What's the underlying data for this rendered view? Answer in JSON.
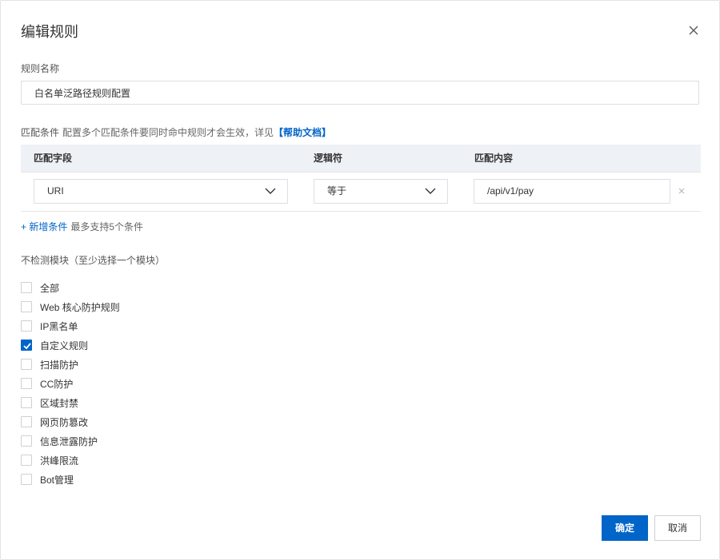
{
  "dialog": {
    "title": "编辑规则",
    "close_icon": "close-icon"
  },
  "rule_name": {
    "label": "规则名称",
    "value": "白名单泛路径规则配置"
  },
  "conditions": {
    "label": "匹配条件",
    "hint": "配置多个匹配条件要同时命中规则才会生效，详见",
    "help_link": "【帮助文档】",
    "columns": [
      "匹配字段",
      "逻辑符",
      "匹配内容"
    ],
    "rows": [
      {
        "field": "URI",
        "operator": "等于",
        "content": "/api/v1/pay"
      }
    ],
    "add_label": "+ 新增条件",
    "add_tip": "最多支持5个条件"
  },
  "modules": {
    "title": "不检测模块（至少选择一个模块）",
    "items": [
      {
        "label": "全部",
        "checked": false
      },
      {
        "label": "Web 核心防护规则",
        "checked": false
      },
      {
        "label": "IP黑名单",
        "checked": false
      },
      {
        "label": "自定义规则",
        "checked": true
      },
      {
        "label": "扫描防护",
        "checked": false
      },
      {
        "label": "CC防护",
        "checked": false
      },
      {
        "label": "区域封禁",
        "checked": false
      },
      {
        "label": "网页防篡改",
        "checked": false
      },
      {
        "label": "信息泄露防护",
        "checked": false
      },
      {
        "label": "洪峰限流",
        "checked": false
      },
      {
        "label": "Bot管理",
        "checked": false
      }
    ]
  },
  "footer": {
    "ok_label": "确定",
    "cancel_label": "取消"
  },
  "colors": {
    "primary": "#0064c8",
    "table_header_bg": "#eef1f6",
    "border": "#dcdfe6"
  }
}
